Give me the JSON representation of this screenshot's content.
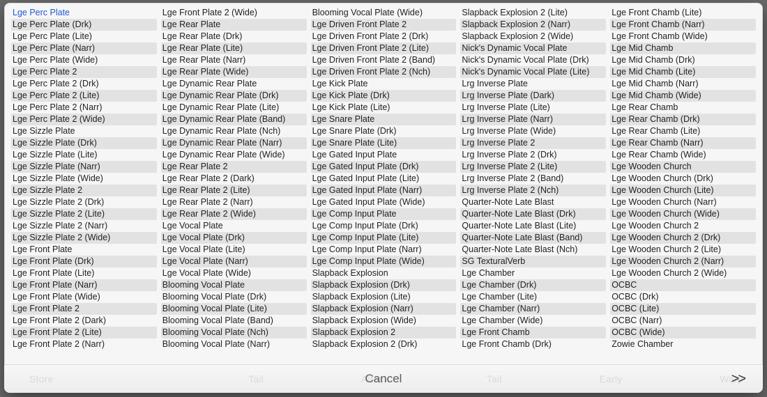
{
  "selected_index": [
    0,
    0
  ],
  "footer": {
    "cancel_label": "Cancel",
    "pager_label": ">>",
    "ghost_labels": [
      "Store",
      "",
      "Tail",
      "Attack",
      "Tail",
      "Early",
      "Warp"
    ]
  },
  "columns": [
    [
      "Lge Perc Plate",
      "Lge Perc Plate (Drk)",
      "Lge Perc Plate (Lite)",
      "Lge Perc Plate (Narr)",
      "Lge Perc Plate (Wide)",
      "Lge Perc Plate 2",
      "Lge Perc Plate 2 (Drk)",
      "Lge Perc Plate 2 (Lite)",
      "Lge Perc Plate 2 (Narr)",
      "Lge Perc Plate 2 (Wide)",
      "Lge Sizzle Plate",
      "Lge Sizzle Plate (Drk)",
      "Lge Sizzle Plate (Lite)",
      "Lge Sizzle Plate (Narr)",
      "Lge Sizzle Plate (Wide)",
      "Lge Sizzle Plate 2",
      "Lge Sizzle Plate 2 (Drk)",
      "Lge Sizzle Plate 2 (Lite)",
      "Lge Sizzle Plate 2 (Narr)",
      "Lge Sizzle Plate 2 (Wide)",
      "Lge Front Plate",
      "Lge Front Plate (Drk)",
      "Lge Front Plate (Lite)",
      "Lge Front Plate (Narr)",
      "Lge Front Plate (Wide)",
      "Lge Front Plate 2",
      "Lge Front Plate 2 (Dark)",
      "Lge Front Plate 2 (Lite)",
      "Lge Front Plate 2 (Narr)"
    ],
    [
      "Lge Front Plate 2 (Wide)",
      "Lge Rear Plate",
      "Lge Rear Plate (Drk)",
      "Lge Rear Plate (Lite)",
      "Lge Rear Plate (Narr)",
      "Lge Rear Plate (Wide)",
      "Lge Dynamic Rear Plate",
      "Lge Dynamic Rear Plate (Drk)",
      "Lge Dynamic Rear Plate (Lite)",
      "Lge Dynamic Rear Plate (Band)",
      "Lge Dynamic Rear Plate (Nch)",
      "Lge Dynamic Rear Plate (Narr)",
      "Lge Dynamic Rear Plate (Wide)",
      "Lge Rear Plate 2",
      "Lge Rear Plate 2 (Dark)",
      "Lge Rear Plate 2 (Lite)",
      "Lge Rear Plate 2 (Narr)",
      "Lge Rear Plate 2 (Wide)",
      "Lge Vocal Plate",
      "Lge Vocal Plate (Drk)",
      "Lge Vocal Plate (Lite)",
      "Lge Vocal Plate (Narr)",
      "Lge Vocal Plate (Wide)",
      "Blooming Vocal Plate",
      "Blooming Vocal Plate (Drk)",
      "Blooming Vocal Plate (Lite)",
      "Blooming Vocal Plate (Band)",
      "Blooming Vocal Plate (Nch)",
      "Blooming Vocal Plate (Narr)"
    ],
    [
      "Blooming Vocal Plate (Wide)",
      "Lge Driven Front Plate 2",
      "Lge Driven Front Plate 2 (Drk)",
      "Lge Driven Front Plate 2 (Lite)",
      "Lge Driven Front Plate 2 (Band)",
      "Lge Driven Front Plate 2 (Nch)",
      "Lge Kick Plate",
      "Lge Kick Plate (Drk)",
      "Lge Kick Plate (Lite)",
      "Lge Snare Plate",
      "Lge Snare Plate (Drk)",
      "Lge Snare Plate (Lite)",
      "Lge Gated Input Plate",
      "Lge Gated Input Plate (Drk)",
      "Lge Gated Input Plate (Lite)",
      "Lge Gated Input Plate (Narr)",
      "Lge Gated Input Plate (Wide)",
      "Lge Comp Input Plate",
      "Lge Comp Input Plate (Drk)",
      "Lge Comp Input Plate (Lite)",
      "Lge Comp Input Plate (Narr)",
      "Lge Comp Input Plate (Wide)",
      "Slapback Explosion",
      "Slapback Explosion (Drk)",
      "Slapback Explosion (Lite)",
      "Slapback Explosion (Narr)",
      "Slapback Explosion (Wide)",
      "Slapback Explosion 2",
      "Slapback Explosion 2 (Drk)"
    ],
    [
      "Slapback Explosion 2 (Lite)",
      "Slapback Explosion 2 (Narr)",
      "Slapback Explosion 2 (Wide)",
      "Nick's Dynamic Vocal Plate",
      "Nick's Dynamic Vocal Plate (Drk)",
      "Nick's Dynamic Vocal Plate (Lite)",
      "Lrg Inverse Plate",
      "Lrg Inverse Plate (Dark)",
      "Lrg Inverse Plate (Lite)",
      "Lrg Inverse Plate (Narr)",
      "Lrg Inverse Plate (Wide)",
      "Lrg Inverse Plate 2",
      "Lrg Inverse Plate 2 (Drk)",
      "Lrg Inverse Plate 2 (Lite)",
      "Lrg Inverse Plate 2 (Band)",
      "Lrg Inverse Plate 2 (Nch)",
      "Quarter-Note Late Blast",
      "Quarter-Note Late Blast (Drk)",
      "Quarter-Note Late Blast (Lite)",
      "Quarter-Note Late Blast (Band)",
      "Quarter-Note Late Blast (Nch)",
      "SG TexturalVerb",
      "Lge Chamber",
      "Lge Chamber (Drk)",
      "Lge Chamber (Lite)",
      "Lge Chamber (Narr)",
      "Lge Chamber (Wide)",
      "Lge Front Chamb",
      "Lge Front Chamb (Drk)"
    ],
    [
      "Lge Front Chamb (Lite)",
      "Lge Front Chamb (Narr)",
      "Lge Front Chamb (Wide)",
      "Lge Mid Chamb",
      "Lge Mid Chamb (Drk)",
      "Lge Mid Chamb (Lite)",
      "Lge Mid Chamb (Narr)",
      "Lge Mid Chamb (Wide)",
      "Lge Rear Chamb",
      "Lge Rear Chamb (Drk)",
      "Lge Rear Chamb (Lite)",
      "Lge Rear Chamb (Narr)",
      "Lge Rear Chamb (Wide)",
      "Lge Wooden Church",
      "Lge Wooden Church (Drk)",
      "Lge Wooden Church (Lite)",
      "Lge Wooden Church (Narr)",
      "Lge Wooden Church (Wide)",
      "Lge Wooden Church 2",
      "Lge Wooden Church 2 (Drk)",
      "Lge Wooden Church 2 (Lite)",
      "Lge Wooden Church 2 (Narr)",
      "Lge Wooden Church 2 (Wide)",
      "OCBC",
      "OCBC (Drk)",
      "OCBC (Lite)",
      "OCBC (Narr)",
      "OCBC (Wide)",
      "Zowie Chamber"
    ]
  ]
}
